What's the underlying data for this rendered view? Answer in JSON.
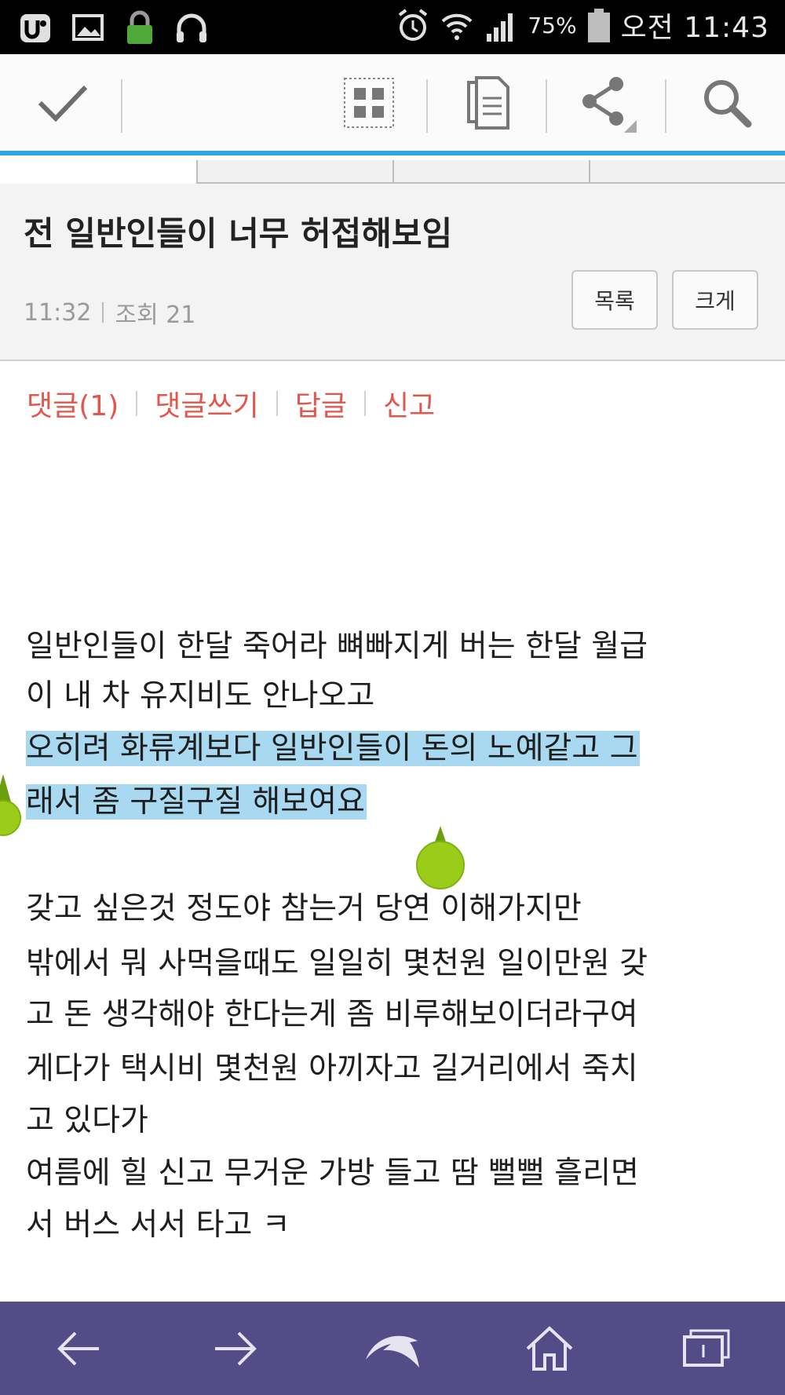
{
  "status_bar": {
    "battery_percent": "75%",
    "time": "오전 11:43",
    "icons_left": [
      "app-notification-icon",
      "image-icon",
      "lock-icon",
      "headphones-icon"
    ],
    "icons_right": [
      "alarm-icon",
      "wifi-icon",
      "signal-icon",
      "battery-icon"
    ]
  },
  "action_bar": {
    "icons": [
      "check-icon",
      "grid-view-icon",
      "copy-icon",
      "share-icon",
      "search-icon"
    ],
    "accent_color": "#2aa8df"
  },
  "post": {
    "title": "전 일반인들이 너무 허접해보임",
    "time": "11:32",
    "views": "조회 21",
    "list_button": "목록",
    "large_button": "크게"
  },
  "links": {
    "comments": "댓글(1)",
    "write_comment": "댓글쓰기",
    "reply": "답글",
    "report": "신고",
    "color": "#e2574c"
  },
  "article": {
    "lines": [
      "일반인들이 한달 죽어라 뼈빠지게 버는 한달 월급",
      "이 내 차 유지비도 안나오고",
      "오히려 화류계보다 일반인들이 돈의 노예같고 그",
      "래서 좀 구질구질 해보여요",
      "갖고 싶은것 정도야 참는거 당연 이해가지만",
      "밖에서 뭐 사먹을때도 일일히 몇천원 일이만원 갖",
      "고 돈 생각해야 한다는게 좀 비루해보이더라구여",
      "게다가 택시비 몇천원 아끼자고 길거리에서 죽치",
      "고 있다가",
      "여름에 힐 신고 무거운 가방 들고 땀 뻘뻘 흘리면",
      "서 버스 서서 타고 ㅋ"
    ],
    "selection_color": "#a9d9f0"
  },
  "bottom_nav": {
    "background": "#544c86",
    "icons": [
      "back-arrow-icon",
      "forward-arrow-icon",
      "dolphin-icon",
      "home-icon",
      "tabs-icon"
    ]
  }
}
